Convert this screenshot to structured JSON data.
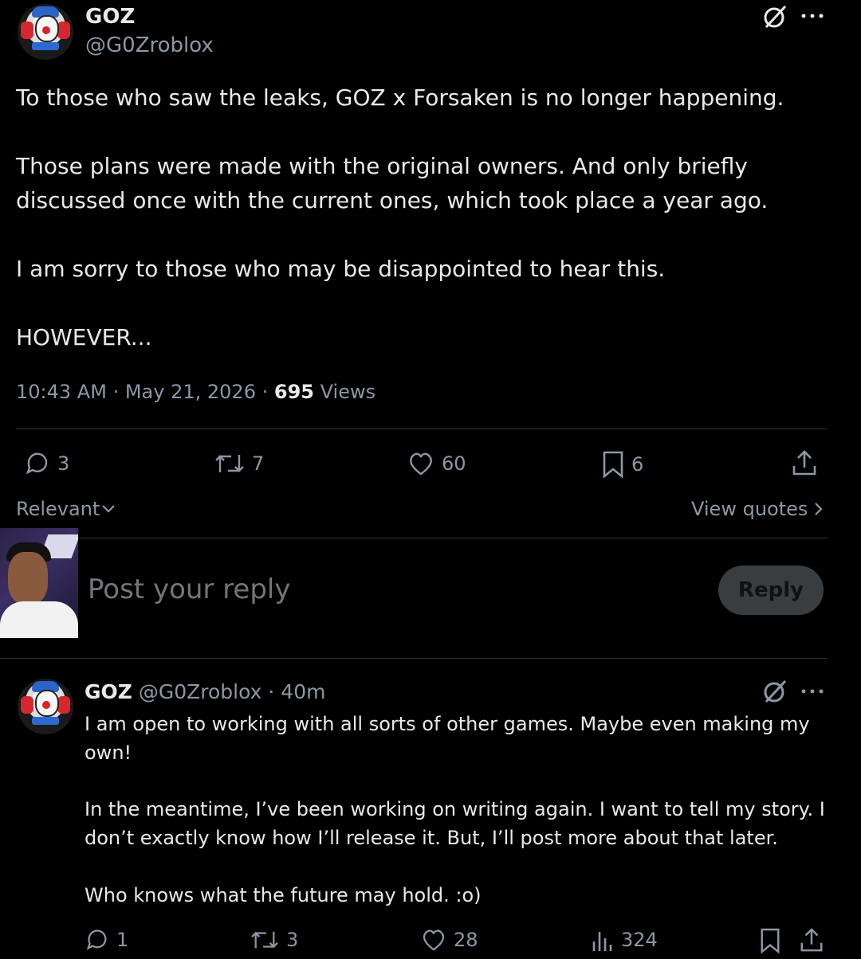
{
  "main_post": {
    "display_name": "GOZ",
    "handle": "@G0Zroblox",
    "paragraphs": [
      "To those who saw the leaks, GOZ x Forsaken is no longer happening.",
      "Those plans were made with the original owners. And only briefly discussed once with the current ones, which took place a year ago.",
      "I am sorry to those who may be disappointed to hear this.",
      "HOWEVER..."
    ],
    "time": "10:43 AM",
    "date": "May 21, 2026",
    "separator": "·",
    "views_count": "695",
    "views_label": "Views",
    "replies": "3",
    "reposts": "7",
    "likes": "60",
    "bookmarks": "6"
  },
  "sort": {
    "label": "Relevant",
    "view_quotes": "View quotes"
  },
  "composer": {
    "placeholder": "Post your reply",
    "reply_button": "Reply"
  },
  "reply": {
    "display_name": "GOZ",
    "handle": "@G0Zroblox",
    "age": "· 40m",
    "paragraphs": [
      "I am open to working with all sorts of other games. Maybe even making my own!",
      "In the meantime, I’ve been working on writing again. I want to tell my story. I don’t exactly know how I’ll release it. But, I’ll post more about that later.",
      "Who knows what the future may hold. :o)"
    ],
    "replies": "1",
    "reposts": "3",
    "likes": "28",
    "views": "324"
  },
  "icons": {
    "grok": "grok-icon",
    "more": "more-icon",
    "reply": "reply-icon",
    "repost": "repost-icon",
    "like": "heart-icon",
    "bookmark": "bookmark-icon",
    "share": "share-icon",
    "views": "views-icon",
    "chevron": "chevron-icon"
  }
}
